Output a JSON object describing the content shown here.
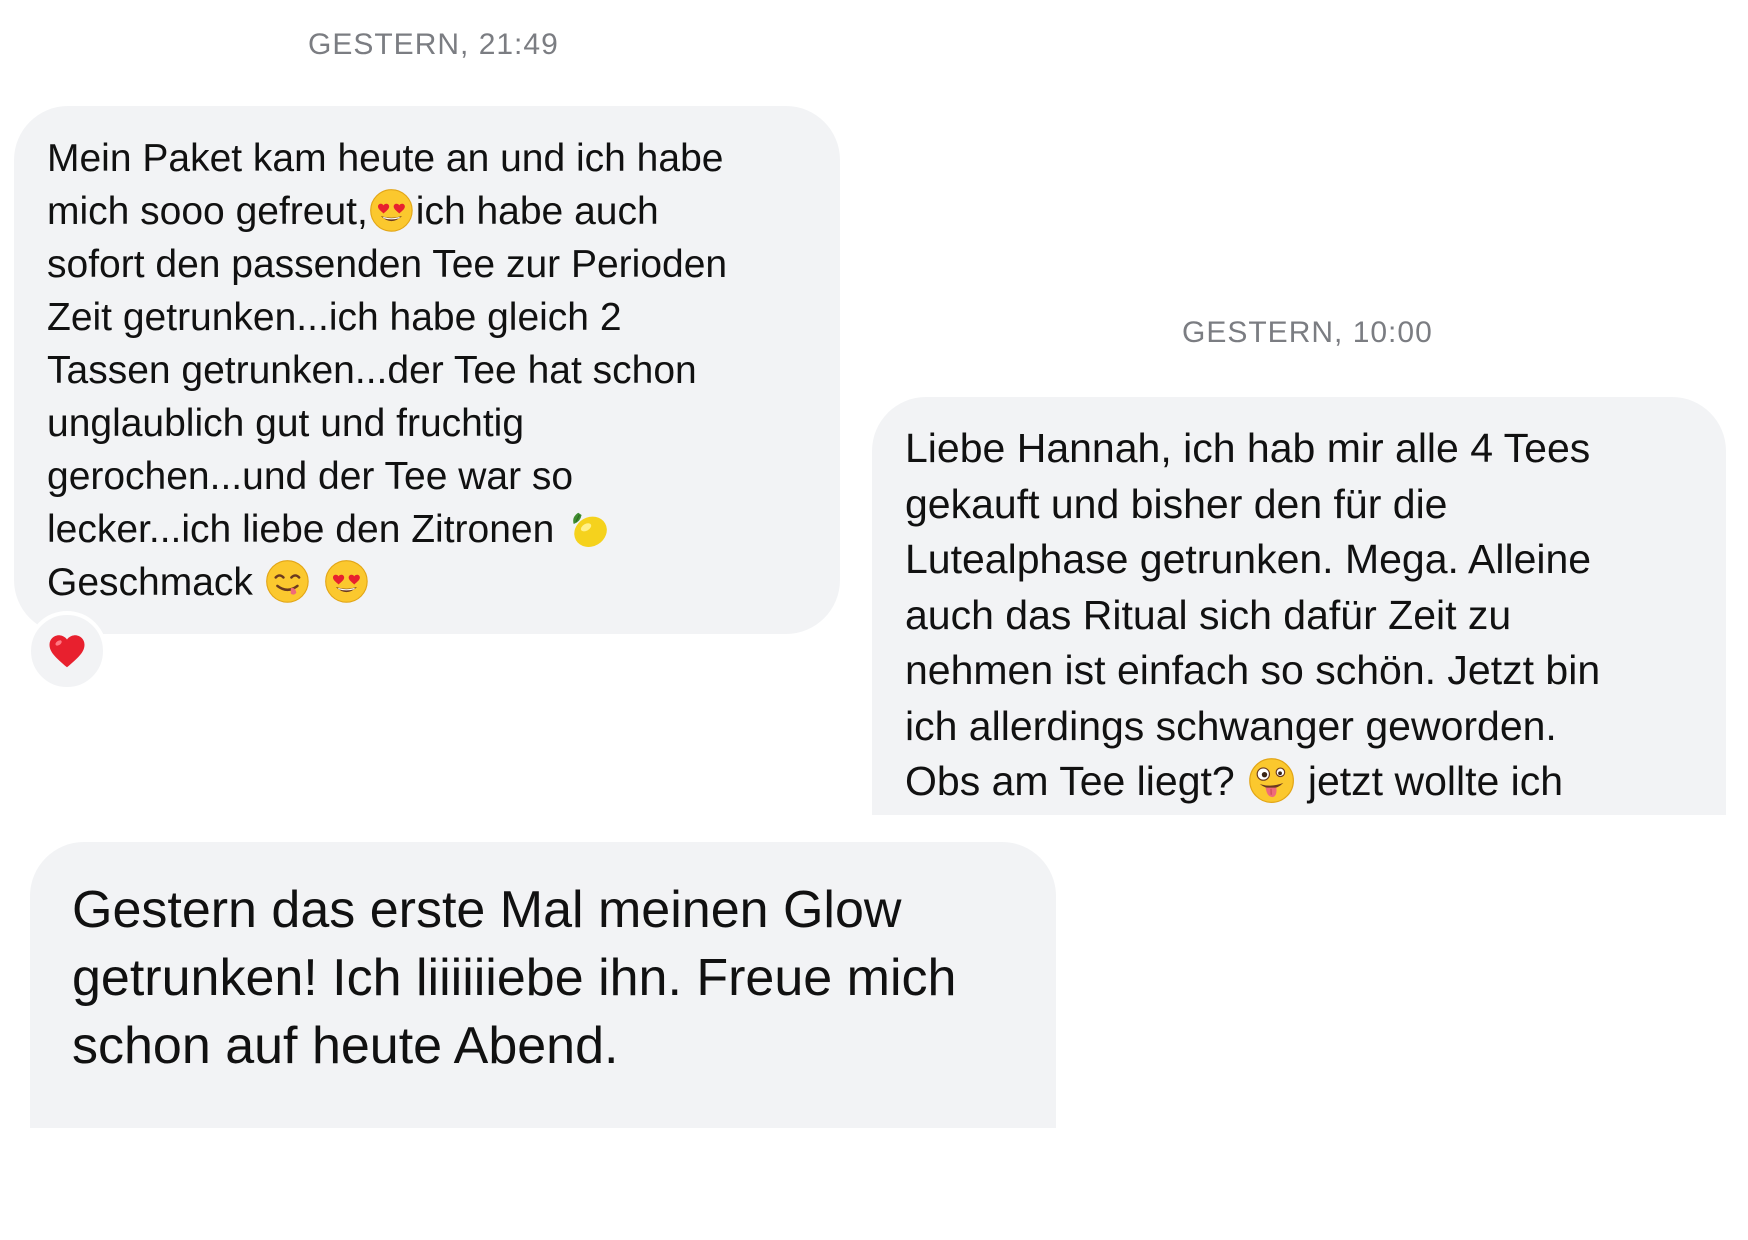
{
  "timestamps": [
    "GESTERN, 21:49",
    "GESTERN, 10:00"
  ],
  "messages": [
    {
      "lines": [
        [
          "Mein Paket kam heute an und ich habe"
        ],
        [
          "mich sooo gefreut,",
          "ich habe auch"
        ],
        [
          "sofort den passenden Tee zur Perioden"
        ],
        [
          "Zeit getrunken...ich habe gleich 2"
        ],
        [
          "Tassen getrunken...der Tee hat schon"
        ],
        [
          "unglaublich gut und fruchtig"
        ],
        [
          "gerochen...und der Tee war so"
        ],
        [
          "lecker...ich liebe den Zitronen "
        ],
        [
          "Geschmack "
        ]
      ],
      "emojis": [
        "heart-eyes-emoji",
        "lemon-emoji",
        "yum-emoji",
        "heart-eyes-emoji"
      ],
      "reaction": "red-heart-icon"
    },
    {
      "lines": [
        [
          "Liebe Hannah, ich hab mir alle 4 Tees"
        ],
        [
          "gekauft und bisher den für die"
        ],
        [
          "Lutealphase getrunken.  Mega. Alleine"
        ],
        [
          "auch das Ritual sich dafür Zeit zu"
        ],
        [
          "nehmen ist einfach so schön. Jetzt bin"
        ],
        [
          "ich allerdings schwanger geworden."
        ],
        [
          "Obs am Tee liegt? ",
          " jetzt wollte ich"
        ]
      ],
      "emojis": [
        "zany-face-emoji"
      ]
    },
    {
      "lines": [
        [
          "Gestern das erste Mal meinen Glow"
        ],
        [
          "getrunken! Ich liiiiiiebe ihn. Freue mich"
        ],
        [
          "schon auf heute Abend."
        ]
      ]
    }
  ],
  "colors": {
    "bubble": "#f2f3f5",
    "timestamp": "#7b7d82",
    "text": "#111111",
    "heart": "#e8202e"
  }
}
